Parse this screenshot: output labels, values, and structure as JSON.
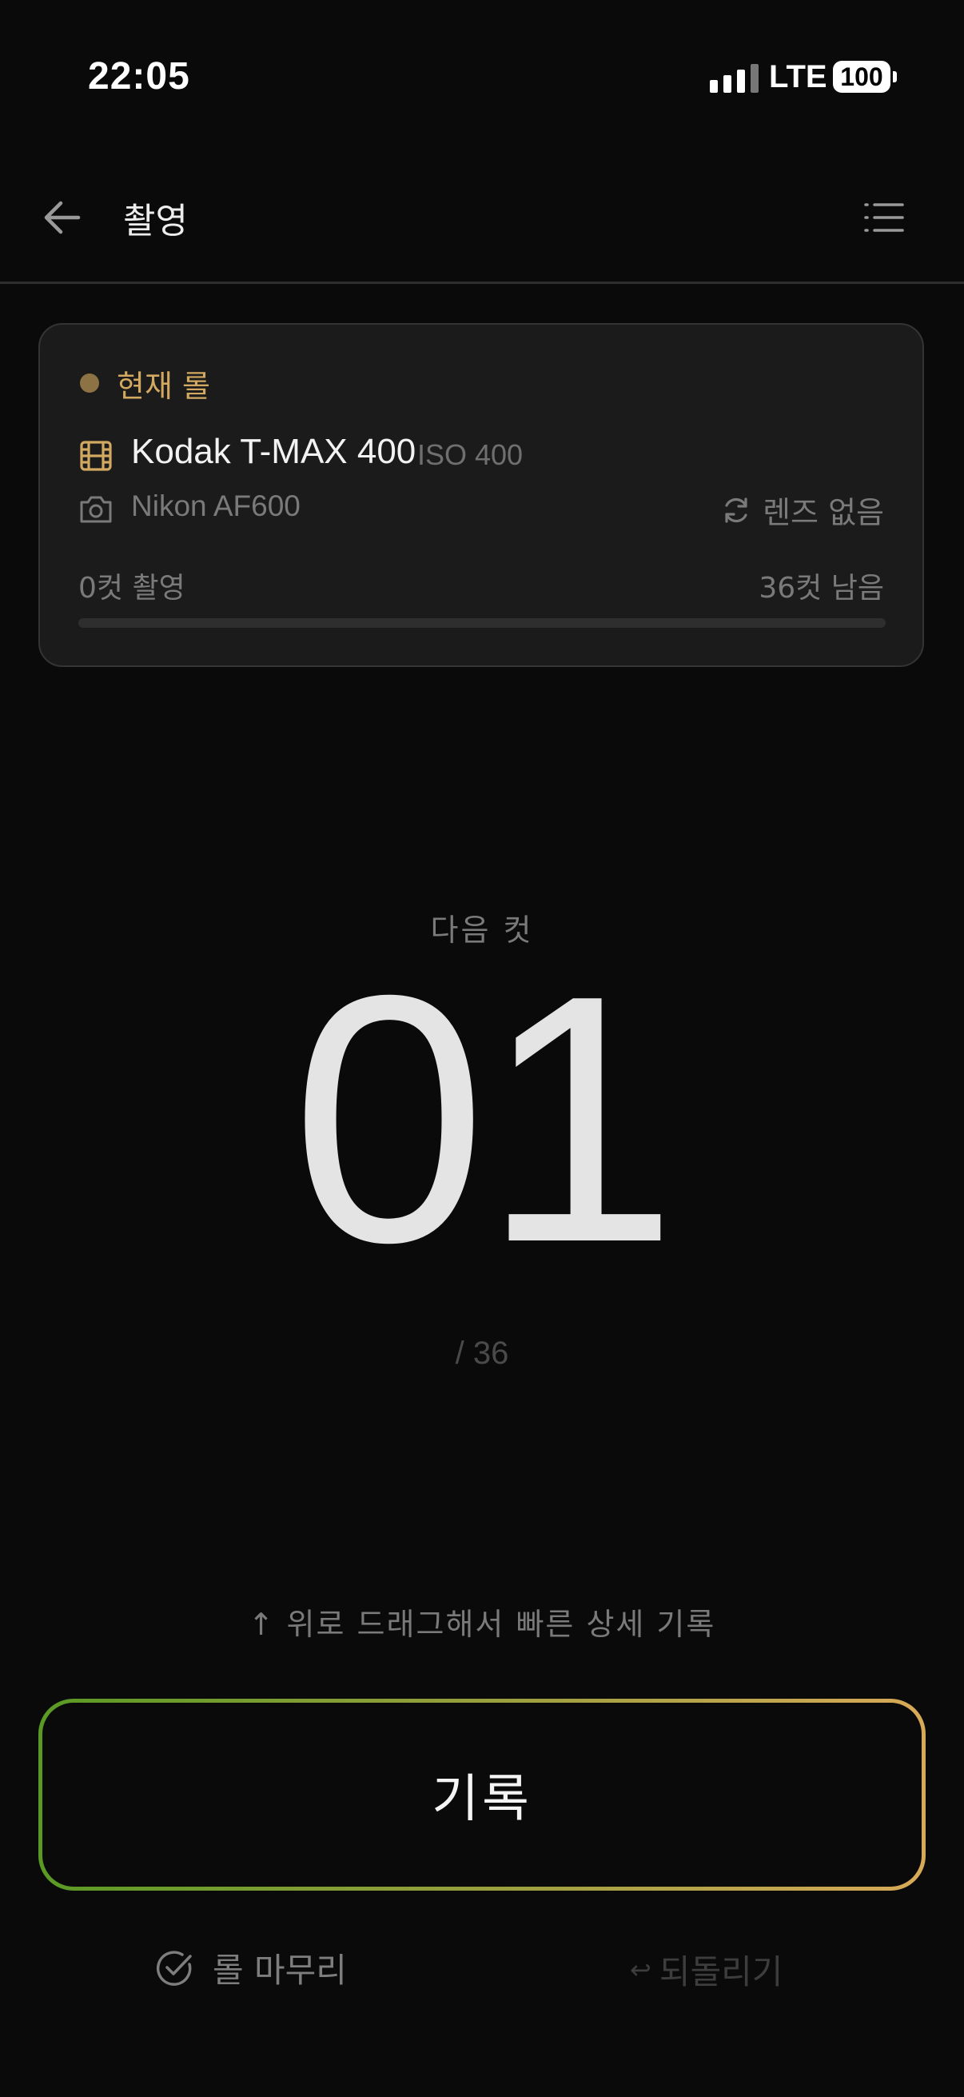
{
  "status_bar": {
    "time": "22:05",
    "network": "LTE",
    "battery": "100"
  },
  "header": {
    "title": "촬영"
  },
  "roll": {
    "current_label": "현재 롤",
    "film_name": "Kodak T-MAX 400",
    "iso": "ISO 400",
    "camera": "Nikon AF600",
    "lens": "렌즈 없음",
    "shot_text": "0컷 촬영",
    "remaining_text": "36컷 남음",
    "progress": 0
  },
  "counter": {
    "next_label": "다음 컷",
    "number": "01",
    "total": "/ 36"
  },
  "hint": "↑ 위로 드래그해서 빠른 상세 기록",
  "actions": {
    "record_label": "기록",
    "finish_label": "롤 마무리",
    "undo_label": "되돌리기",
    "undo_icon": "↩"
  },
  "colors": {
    "accent": "#d3a861",
    "green": "#5a9a24",
    "background": "#0a0a0a",
    "card": "#1b1b1b"
  },
  "icons": [
    "back-arrow-icon",
    "list-menu-icon",
    "film-icon",
    "camera-icon",
    "refresh-icon",
    "check-circle-icon",
    "undo-icon"
  ]
}
